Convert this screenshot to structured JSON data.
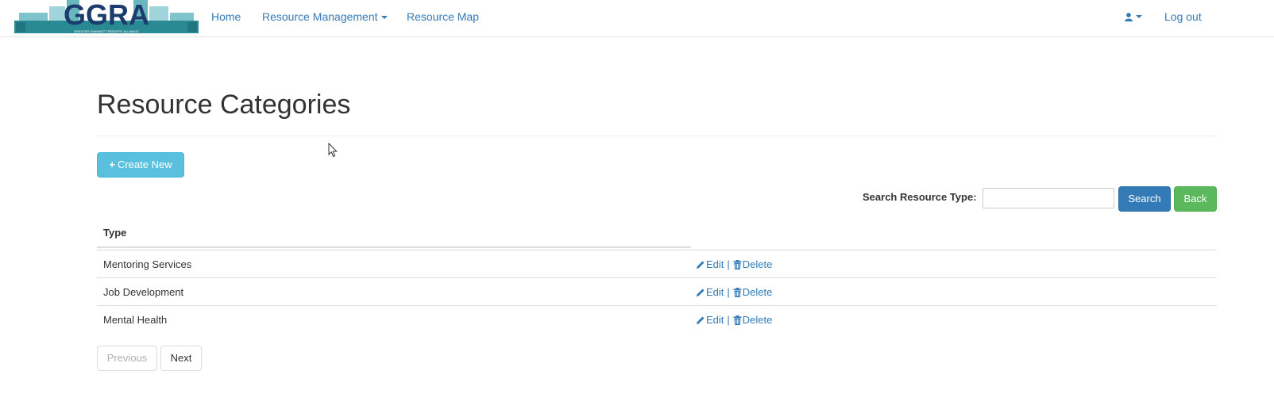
{
  "brand": {
    "logo_text": "GGRA",
    "logo_subtitle": "GREATER GWINNETT REENTRY ALLIANCE"
  },
  "nav": {
    "home": "Home",
    "resource_management": "Resource Management",
    "resource_map": "Resource Map",
    "logout": "Log out",
    "user_icon": "user-icon"
  },
  "page": {
    "title": "Resource Categories"
  },
  "toolbar": {
    "create_label": "Create New",
    "create_icon": "+",
    "search_label": "Search Resource Type:",
    "search_value": "",
    "search_placeholder": "",
    "search_button": "Search",
    "back_button": "Back"
  },
  "table": {
    "header_type": "Type",
    "rows": [
      {
        "type": "Mentoring Services",
        "edit": "Edit",
        "separator": "|",
        "delete": "Delete"
      },
      {
        "type": "Job Development",
        "edit": "Edit",
        "separator": "|",
        "delete": "Delete"
      },
      {
        "type": "Mental Health",
        "edit": "Edit",
        "separator": "|",
        "delete": "Delete"
      }
    ]
  },
  "pager": {
    "previous": "Previous",
    "next": "Next"
  },
  "colors": {
    "link": "#337ab7",
    "info": "#5bc0de",
    "primary": "#337ab7",
    "success": "#5cb85c",
    "logo_teal": "#2a8a94",
    "logo_navy": "#1d3c6e"
  }
}
